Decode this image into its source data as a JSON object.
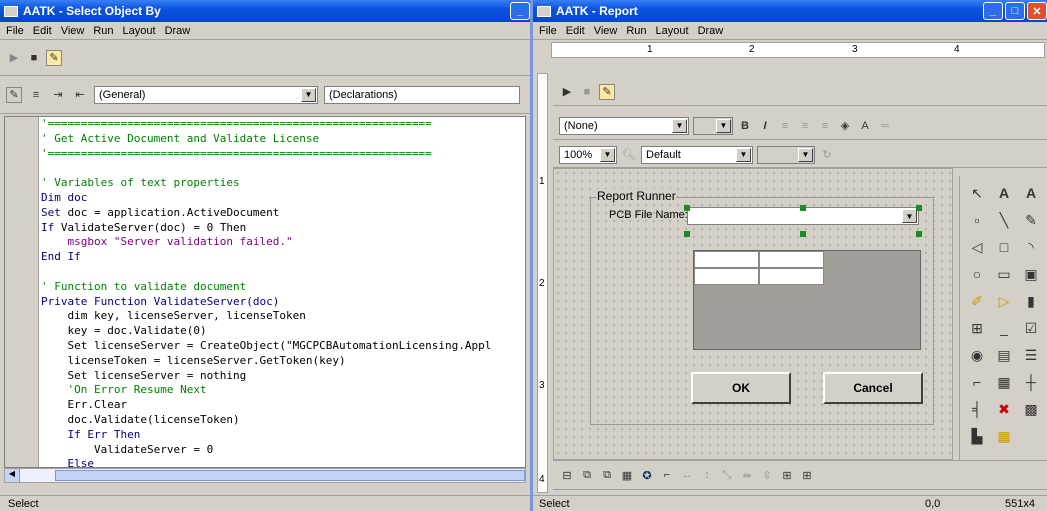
{
  "left_window": {
    "title": "AATK - Select Object By",
    "menu": [
      "File",
      "Edit",
      "View",
      "Run",
      "Layout",
      "Draw"
    ],
    "object_combo": "(General)",
    "proc_combo": "(Declarations)",
    "status": "Select"
  },
  "code": [
    {
      "t": "cm",
      "s": "'=========================================================="
    },
    {
      "t": "cm",
      "s": "' Get Active Document and Validate License"
    },
    {
      "t": "cm",
      "s": "'=========================================================="
    },
    {
      "t": "",
      "s": ""
    },
    {
      "t": "cm",
      "s": "' Variables of text properties"
    },
    {
      "t": "kw",
      "s": "Dim doc"
    },
    {
      "t": "mix",
      "k": "Set",
      "s": " doc = application.ActiveDocument"
    },
    {
      "t": "mix",
      "k": "If",
      "s": " ValidateServer(doc) = 0 Then"
    },
    {
      "t": "msg",
      "s": "    msgbox \"Server validation failed.\""
    },
    {
      "t": "kw",
      "s": "End If"
    },
    {
      "t": "",
      "s": ""
    },
    {
      "t": "cm",
      "s": "' Function to validate document"
    },
    {
      "t": "kw",
      "s": "Private Function ValidateServer(doc)"
    },
    {
      "t": "",
      "s": "    dim key, licenseServer, licenseToken"
    },
    {
      "t": "",
      "s": "    key = doc.Validate(0)"
    },
    {
      "t": "",
      "s": "    Set licenseServer = CreateObject(\"MGCPCBAutomationLicensing.Appl"
    },
    {
      "t": "",
      "s": "    licenseToken = licenseServer.GetToken(key)"
    },
    {
      "t": "",
      "s": "    Set licenseServer = nothing"
    },
    {
      "t": "cm",
      "s": "    'On Error Resume Next"
    },
    {
      "t": "",
      "s": "    Err.Clear"
    },
    {
      "t": "",
      "s": "    doc.Validate(licenseToken)"
    },
    {
      "t": "kw",
      "s": "    If Err Then"
    },
    {
      "t": "",
      "s": "        ValidateServer = 0"
    },
    {
      "t": "kw",
      "s": "    Else"
    }
  ],
  "right_window": {
    "title": "AATK - Report",
    "menu": [
      "File",
      "Edit",
      "View",
      "Run",
      "Layout",
      "Draw"
    ],
    "style_combo": "(None)",
    "zoom_combo": "100%",
    "font_combo": "Default",
    "ruler_marks": [
      "1",
      "2",
      "3",
      "4"
    ],
    "vruler_marks": [
      "1",
      "2",
      "3",
      "4"
    ],
    "group_title": "Report Runner",
    "pcb_label": "PCB File Name:",
    "ok_label": "OK",
    "cancel_label": "Cancel",
    "status": "Select",
    "coords": "0,0",
    "size": "551x4"
  }
}
